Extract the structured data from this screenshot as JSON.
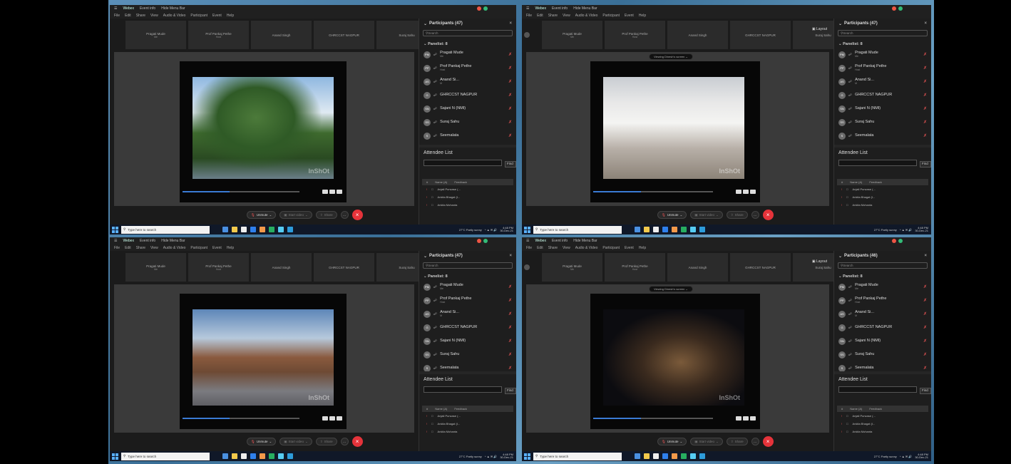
{
  "app": {
    "name": "Webex",
    "account": "Event info",
    "meeting": "Hide Menu Bar"
  },
  "menu": [
    "File",
    "Edit",
    "Share",
    "View",
    "Audio & Video",
    "Participant",
    "Event",
    "Help"
  ],
  "strip_tiles": [
    {
      "name": "Pragati Mude",
      "sub": "Me"
    },
    {
      "name": "Prof Pankaj Pethe",
      "sub": "Host"
    },
    {
      "name": "Anand Singh",
      "sub": ""
    },
    {
      "name": "GHRCCST NAGPUR",
      "sub": ""
    },
    {
      "name": "Suraj Sahu",
      "sub": ""
    },
    {
      "name": "Sajni N (NMI)",
      "sub": ""
    }
  ],
  "layout_label": "Layout",
  "viewing_label": "Viewing Dinesh's screen",
  "watermark": "InShOt",
  "controls": {
    "unmute": "Unmute",
    "start_video": "Start video",
    "share": "Share",
    "more": "...",
    "end": "×"
  },
  "panel": {
    "participants_q1": "Participants (47)",
    "participants_q2": "Participants (47)",
    "participants_q3": "Participants (47)",
    "participants_q4": "Participants (46)",
    "search_placeholder": "Search",
    "panelists": "Panelist: 8",
    "people": [
      {
        "init": "PM",
        "name": "Pragati Mude",
        "sub": "Me"
      },
      {
        "init": "PP",
        "name": "Prof Pankaj Pethe",
        "sub": "Host"
      },
      {
        "init": "AS",
        "name": "Anand Si...",
        "sub": "M"
      },
      {
        "init": "G",
        "name": "GHRCCST NAGPUR",
        "sub": ""
      },
      {
        "init": "SN",
        "name": "Sajani N (NMI)",
        "sub": ""
      },
      {
        "init": "SS",
        "name": "Suraj Sahu",
        "sub": ""
      },
      {
        "init": "S",
        "name": "Seemalata",
        "sub": ""
      }
    ],
    "attendee_title": "Attendee List",
    "find": "Find",
    "att_cols": [
      "#",
      "Name (A)",
      "Feedback"
    ],
    "att_rows": [
      "Anjali Punvase (...",
      "Ankita Bhagat (I...",
      "Ankita Mohanta"
    ]
  },
  "taskbar": {
    "search": "Type here to search",
    "weather": "27°C  Partly sunny",
    "time": "4:48 PM",
    "date": "30-Dec-21"
  }
}
